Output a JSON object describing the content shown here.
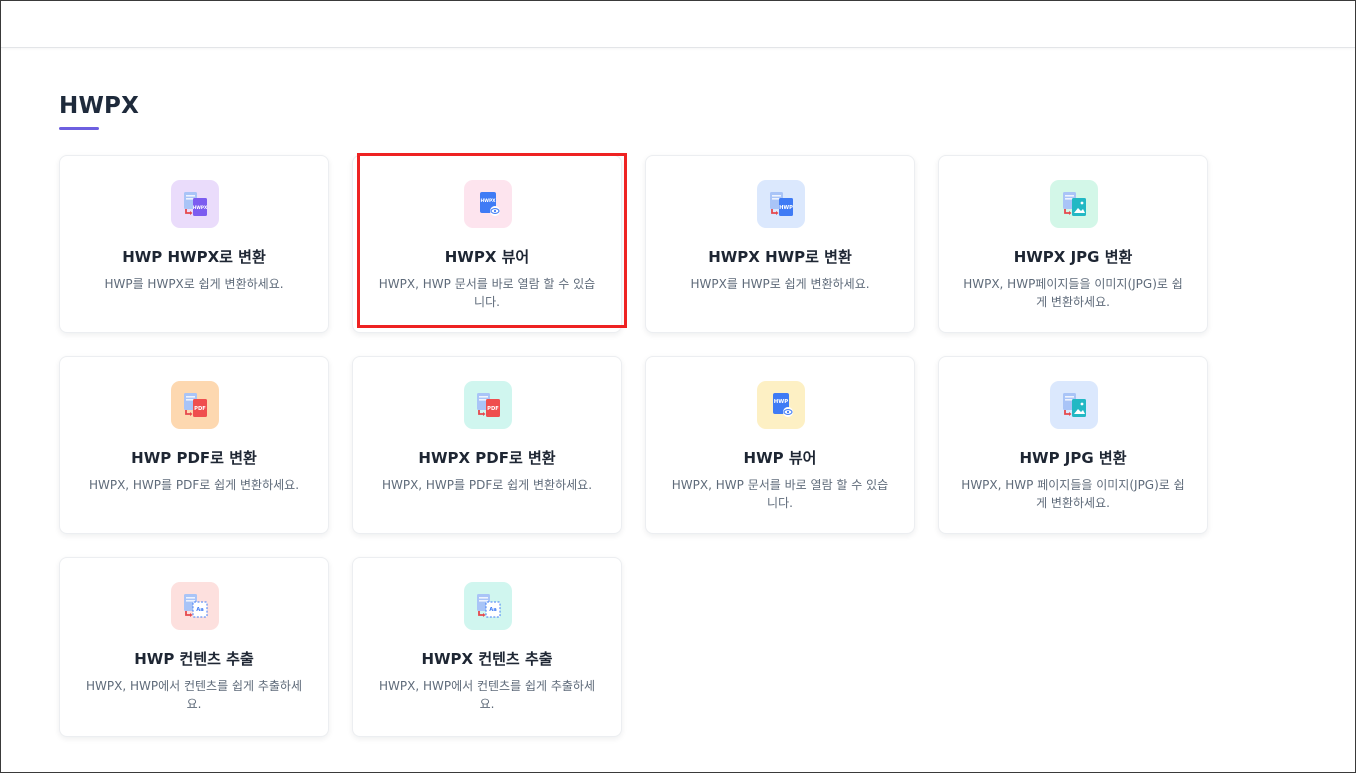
{
  "section": {
    "title": "HWPX"
  },
  "cards": [
    {
      "title": "HWP HWPX로 변환",
      "description": "HWP를 HWPX로 쉽게 변환하세요.",
      "icon": "convert-hwpx-icon",
      "icon_label": "HWPX",
      "icon_bg": "#eadcfb",
      "icon_color": "#7c5cf0"
    },
    {
      "title": "HWPX 뷰어",
      "description": "HWPX, HWP 문서를 바로 열람 할 수 있습니다.",
      "icon": "hwpx-viewer-icon",
      "icon_label": "HWPX",
      "icon_bg": "#fde4ee",
      "icon_color": "#3f7bf5"
    },
    {
      "title": "HWPX HWP로 변환",
      "description": "HWPX를 HWP로 쉽게 변환하세요.",
      "icon": "convert-hwp-icon",
      "icon_label": "HWP",
      "icon_bg": "#dbe8fd",
      "icon_color": "#3f7bf5"
    },
    {
      "title": "HWPX JPG 변환",
      "description": "HWPX, HWP페이지들을 이미지(JPG)로 쉽게 변환하세요.",
      "icon": "convert-jpg-icon",
      "icon_label": "",
      "icon_bg": "#d3f7e8",
      "icon_color": "#22b8c4"
    },
    {
      "title": "HWP PDF로 변환",
      "description": "HWPX, HWP를 PDF로 쉽게 변환하세요.",
      "icon": "convert-pdf-icon",
      "icon_label": "PDF",
      "icon_bg": "#fdd8b0",
      "icon_color": "#ef4e4e"
    },
    {
      "title": "HWPX PDF로 변환",
      "description": "HWPX, HWP를 PDF로 쉽게 변환하세요.",
      "icon": "convert-pdf-icon",
      "icon_label": "PDF",
      "icon_bg": "#d0f6ef",
      "icon_color": "#ef4e4e"
    },
    {
      "title": "HWP 뷰어",
      "description": "HWPX, HWP 문서를 바로 열람 할 수 있습니다.",
      "icon": "hwp-viewer-icon",
      "icon_label": "HWP",
      "icon_bg": "#fdf0c4",
      "icon_color": "#3f7bf5"
    },
    {
      "title": "HWP JPG 변환",
      "description": "HWPX, HWP 페이지들을 이미지(JPG)로 쉽게 변환하세요.",
      "icon": "convert-jpg-icon",
      "icon_label": "",
      "icon_bg": "#dbe8fd",
      "icon_color": "#22b8c4"
    },
    {
      "title": "HWP 컨텐츠 추출",
      "description": "HWPX, HWP에서 컨텐츠를 쉽게 추출하세요.",
      "icon": "extract-content-icon",
      "icon_label": "Aa",
      "icon_bg": "#fde0de",
      "icon_color": "#3f7bf5"
    },
    {
      "title": "HWPX 컨텐츠 추출",
      "description": "HWPX, HWP에서 컨텐츠를 쉽게 추출하세요.",
      "icon": "extract-content-icon",
      "icon_label": "Aa",
      "icon_bg": "#d0f6ef",
      "icon_color": "#3f7bf5"
    }
  ],
  "colors": {
    "accent": "#6d5fe0",
    "highlight": "#ee2222"
  }
}
